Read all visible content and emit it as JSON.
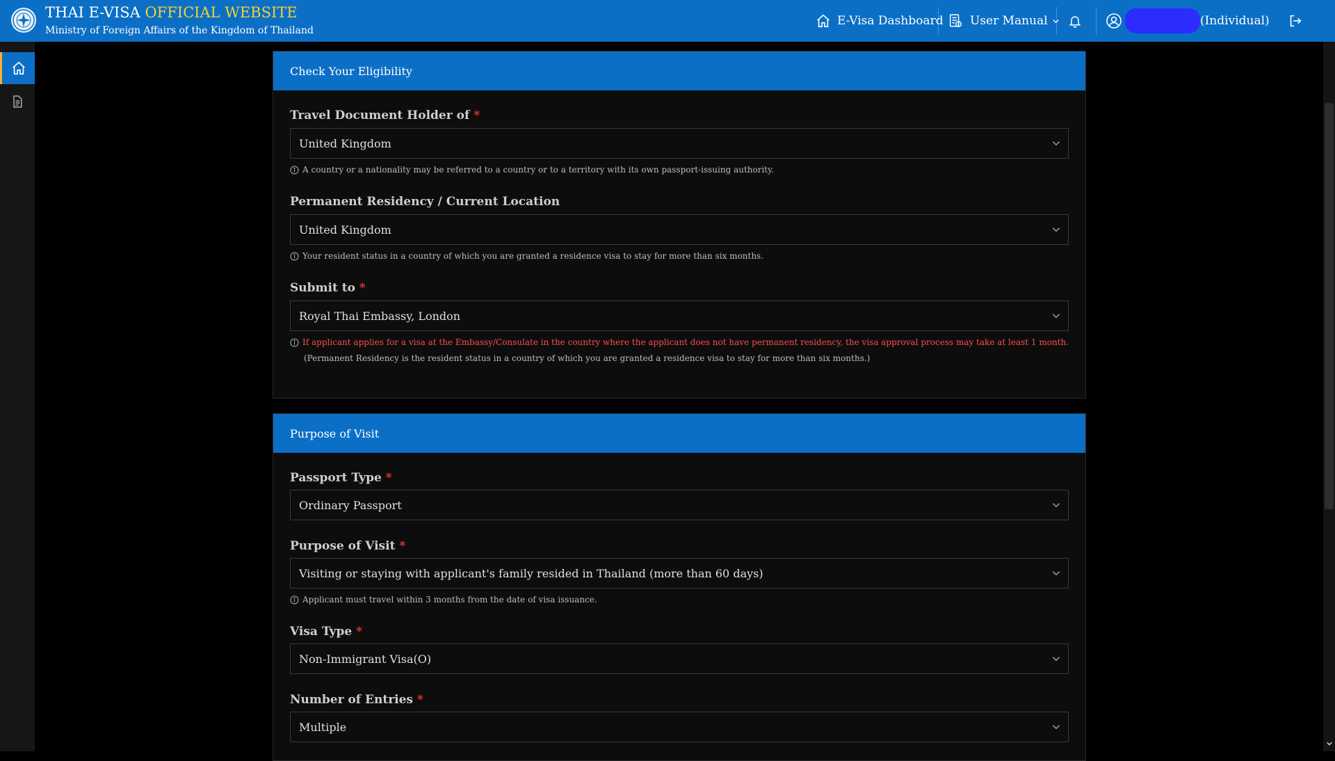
{
  "header": {
    "title_part1": "THAI E-VISA",
    "title_part2": "OFFICIAL WEBSITE",
    "subtitle": "Ministry of Foreign Affairs of the Kingdom of Thailand",
    "nav": {
      "dashboard": "E-Visa Dashboard",
      "manual": "User Manual",
      "user_role": "(Individual)"
    },
    "accent_color": "#0b6fc6",
    "highlight_color": "#f3d234"
  },
  "sidebar": {
    "items": [
      {
        "icon": "home-icon",
        "active": true
      },
      {
        "icon": "document-icon",
        "active": false
      }
    ]
  },
  "eligibility": {
    "heading": "Check Your Eligibility",
    "travel_doc": {
      "label": "Travel Document Holder of",
      "value": "United Kingdom",
      "hint": "A country or a nationality may be referred to a country or to a territory with its own passport-issuing authority."
    },
    "residency": {
      "label": "Permanent Residency / Current Location",
      "value": "United Kingdom",
      "hint": "Your resident status in a country of which you are granted a residence visa to stay for more than six months."
    },
    "submit_to": {
      "label": "Submit to",
      "value": "Royal Thai Embassy, London",
      "warning": "If applicant applies for a visa at the Embassy/Consulate in the country where the applicant does not have permanent residency, the visa approval process may take at least 1 month.",
      "note": "(Permanent Residency is the resident status in a country of which you are granted a residence visa to stay for more than six months.)"
    }
  },
  "purpose": {
    "heading": "Purpose of Visit",
    "passport_type": {
      "label": "Passport Type",
      "value": "Ordinary Passport"
    },
    "purpose_of_visit": {
      "label": "Purpose of Visit",
      "value": "Visiting or staying with applicant's family resided in Thailand (more than 60 days)",
      "hint": "Applicant must travel within 3 months from the date of visa issuance."
    },
    "visa_type": {
      "label": "Visa Type",
      "value": "Non-Immigrant Visa(O)"
    },
    "entries": {
      "label": "Number of Entries",
      "value": "Multiple"
    }
  },
  "required_mark": "*"
}
